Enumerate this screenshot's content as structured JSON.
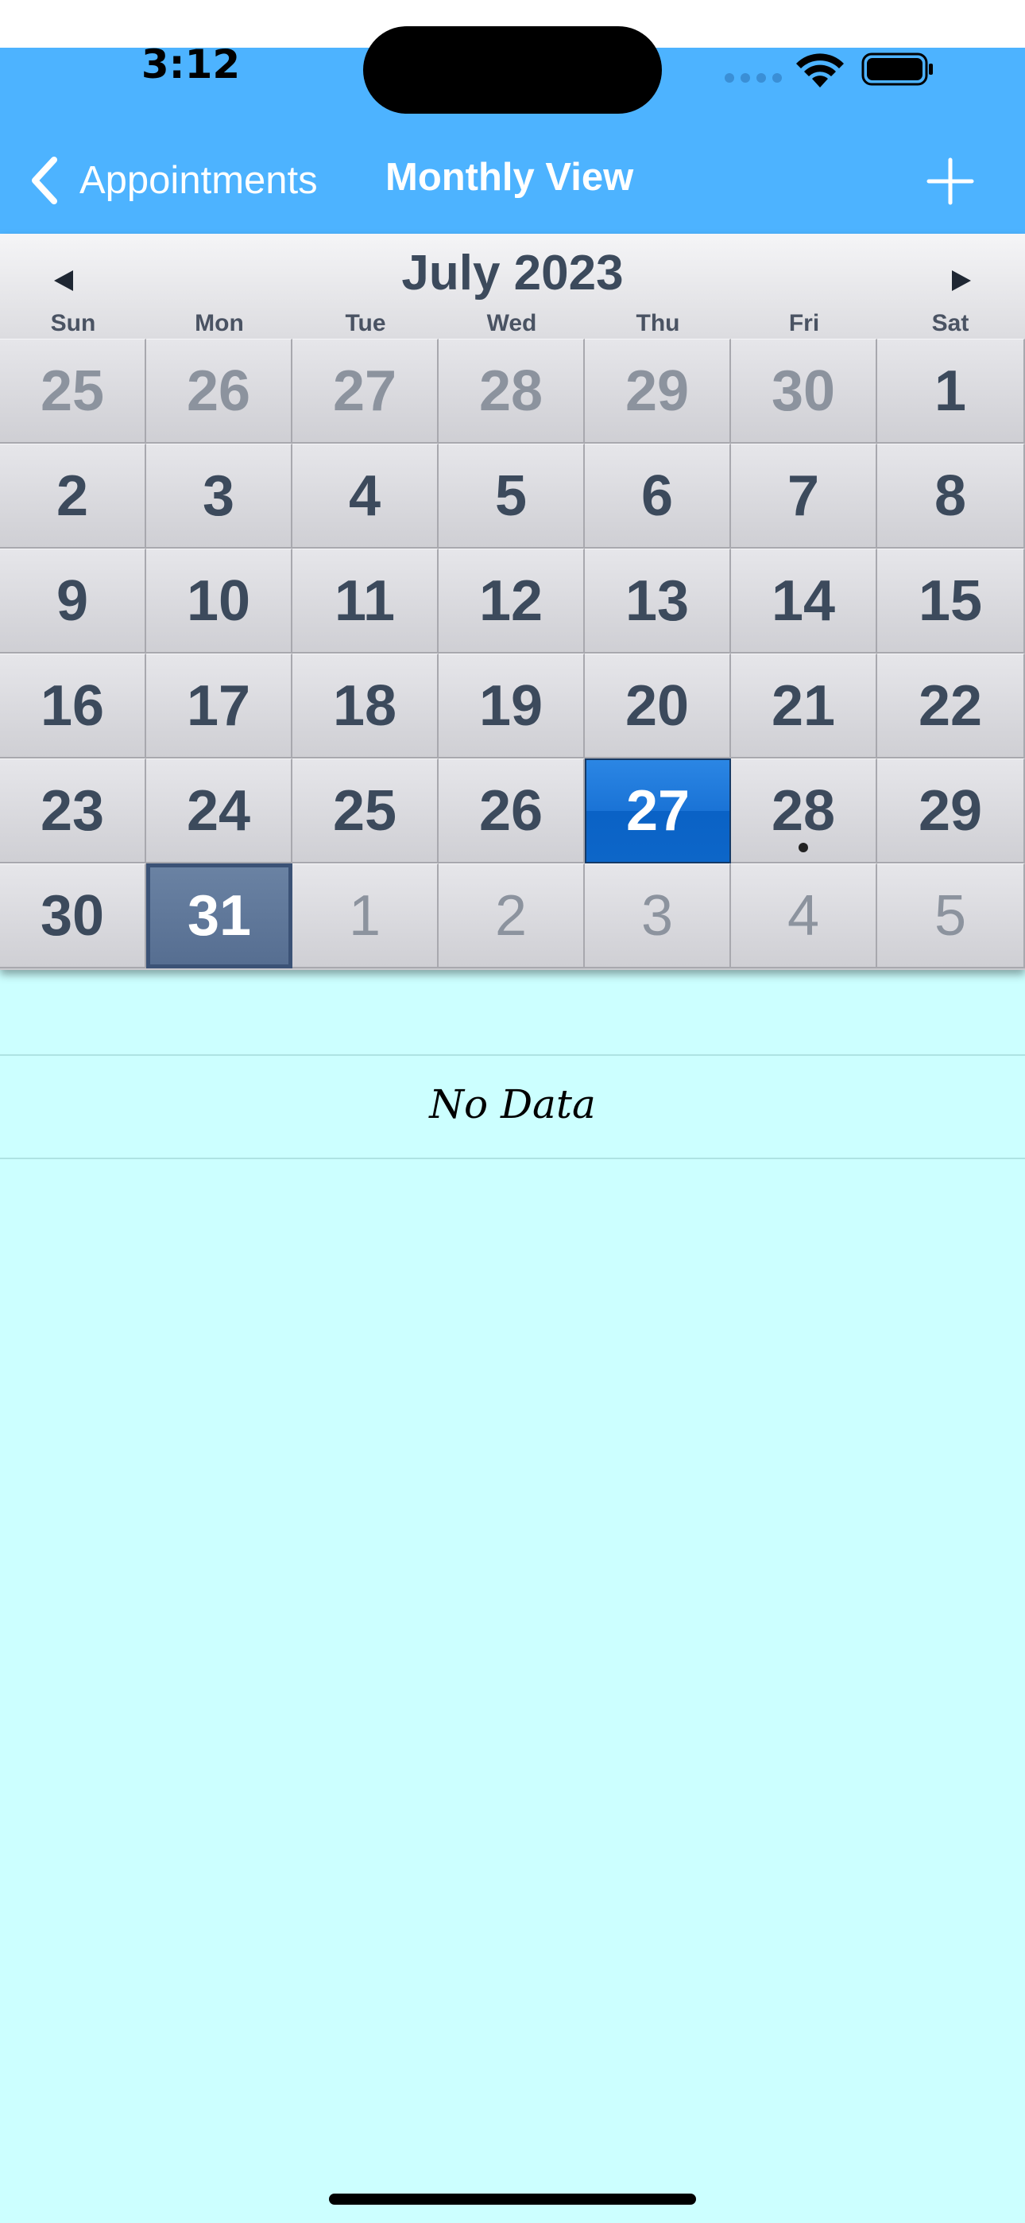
{
  "status_bar": {
    "time": "3:12"
  },
  "nav": {
    "back_label": "Appointments",
    "title": "Monthly View"
  },
  "calendar": {
    "month_title": "July 2023",
    "weekdays": [
      "Sun",
      "Mon",
      "Tue",
      "Wed",
      "Thu",
      "Fri",
      "Sat"
    ],
    "weeks": [
      [
        "25",
        "26",
        "27",
        "28",
        "29",
        "30",
        "1"
      ],
      [
        "2",
        "3",
        "4",
        "5",
        "6",
        "7",
        "8"
      ],
      [
        "9",
        "10",
        "11",
        "12",
        "13",
        "14",
        "15"
      ],
      [
        "16",
        "17",
        "18",
        "19",
        "20",
        "21",
        "22"
      ],
      [
        "23",
        "24",
        "25",
        "26",
        "27",
        "28",
        "29"
      ],
      [
        "30",
        "31",
        "1",
        "2",
        "3",
        "4",
        "5"
      ]
    ],
    "selected_day": "27",
    "today_day": "31",
    "event_day": "28"
  },
  "list": {
    "empty_text": "No Data"
  },
  "colors": {
    "header": "#4db3ff",
    "content_bg": "#ccffff",
    "selected_day": "#1a73d6",
    "today_day": "#566e91"
  }
}
